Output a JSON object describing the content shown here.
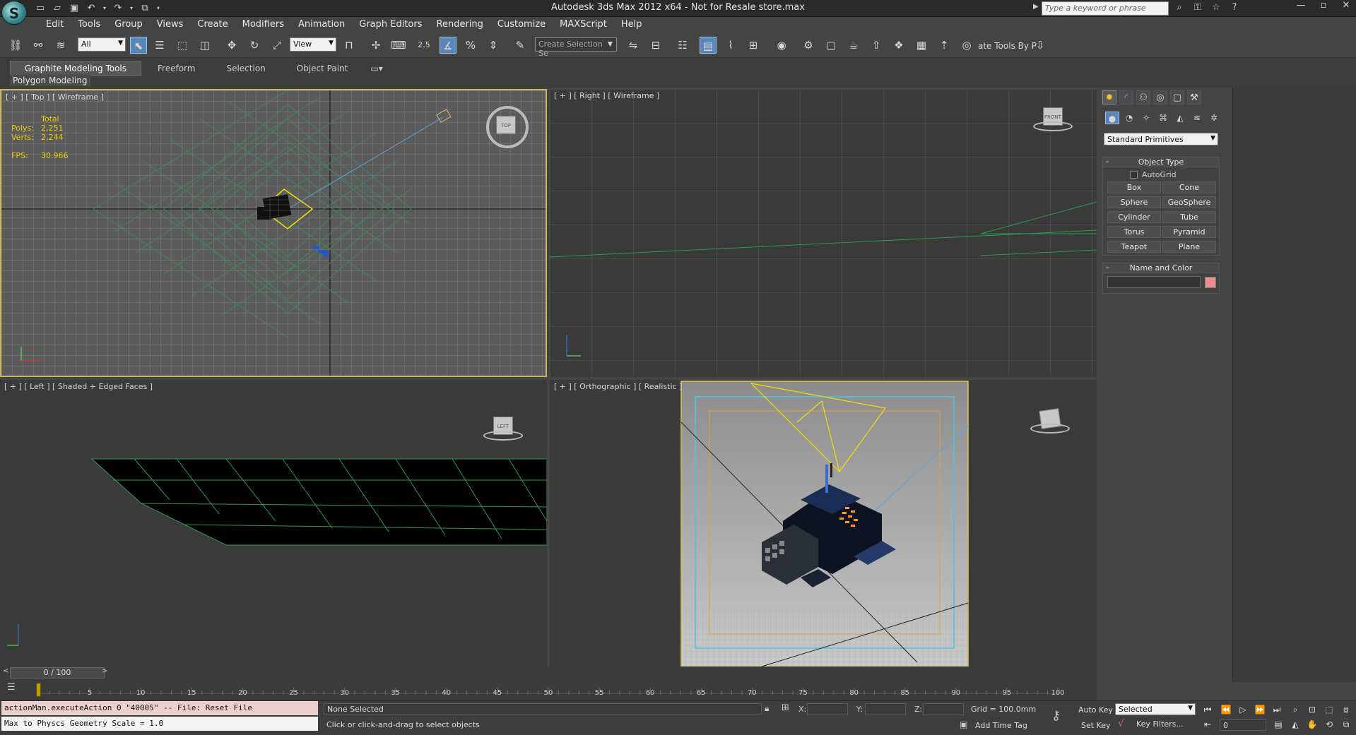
{
  "app": {
    "title": "Autodesk 3ds Max  2012 x64    - Not for Resale    store.max",
    "logo": "S"
  },
  "search": {
    "placeholder": "Type a keyword or phrase"
  },
  "menus": [
    "Edit",
    "Tools",
    "Group",
    "Views",
    "Create",
    "Modifiers",
    "Animation",
    "Graph Editors",
    "Rendering",
    "Customize",
    "MAXScript",
    "Help"
  ],
  "toolbar": {
    "selection_filter": "All",
    "ref_coord": "View",
    "snap_value": "2.5",
    "named_selection_placeholder": "Create Selection Se",
    "right_text": "ate Tools By P"
  },
  "ribbon": {
    "tabs": [
      "Graphite Modeling Tools",
      "Freeform",
      "Selection",
      "Object Paint"
    ],
    "sub_label": "Polygon Modeling"
  },
  "viewports": {
    "top": {
      "label": "[ + ] [ Top ] [ Wireframe ]",
      "cube_label": "TOP"
    },
    "right": {
      "label": "[ + ] [ Right ] [ Wireframe ]",
      "cube_label": "FRONT"
    },
    "left": {
      "label": "[ + ] [ Left ] [ Shaded + Edged Faces ]",
      "cube_label": "LEFT"
    },
    "ortho": {
      "label": "[ + ] [ Orthographic ] [ Realistic ]"
    }
  },
  "stats": {
    "total_label": "Total",
    "polys_label": "Polys:",
    "polys": "2,251",
    "verts_label": "Verts:",
    "verts": "2,244",
    "fps_label": "FPS:",
    "fps": "30.966"
  },
  "command_panel": {
    "category": "Standard Primitives",
    "object_type_title": "Object Type",
    "autogrid_label": "AutoGrid",
    "primitives": [
      "Box",
      "Cone",
      "Sphere",
      "GeoSphere",
      "Cylinder",
      "Tube",
      "Torus",
      "Pyramid",
      "Teapot",
      "Plane"
    ],
    "name_color_title": "Name and Color",
    "object_color": "#f08c8c"
  },
  "timeline": {
    "slider_label": "0 / 100",
    "ticks": [
      "5",
      "10",
      "15",
      "20",
      "25",
      "30",
      "35",
      "40",
      "45",
      "50",
      "55",
      "60",
      "65",
      "70",
      "75",
      "80",
      "85",
      "90",
      "95",
      "100"
    ]
  },
  "status": {
    "maxscript_line1": "actionMan.executeAction 0 \"40005\"  -- File: Reset File",
    "maxscript_line2": "Max to Physcs Geometry Scale = 1.0",
    "selection": "None Selected",
    "prompt": "Click or click-and-drag to select objects",
    "x_label": "X:",
    "y_label": "Y:",
    "z_label": "Z:",
    "grid": "Grid = 100.0mm",
    "add_time_tag": "Add Time Tag",
    "auto_key": "Auto Key",
    "set_key": "Set Key",
    "key_mode": "Selected",
    "key_filters": "Key Filters...",
    "current_frame": "0"
  }
}
